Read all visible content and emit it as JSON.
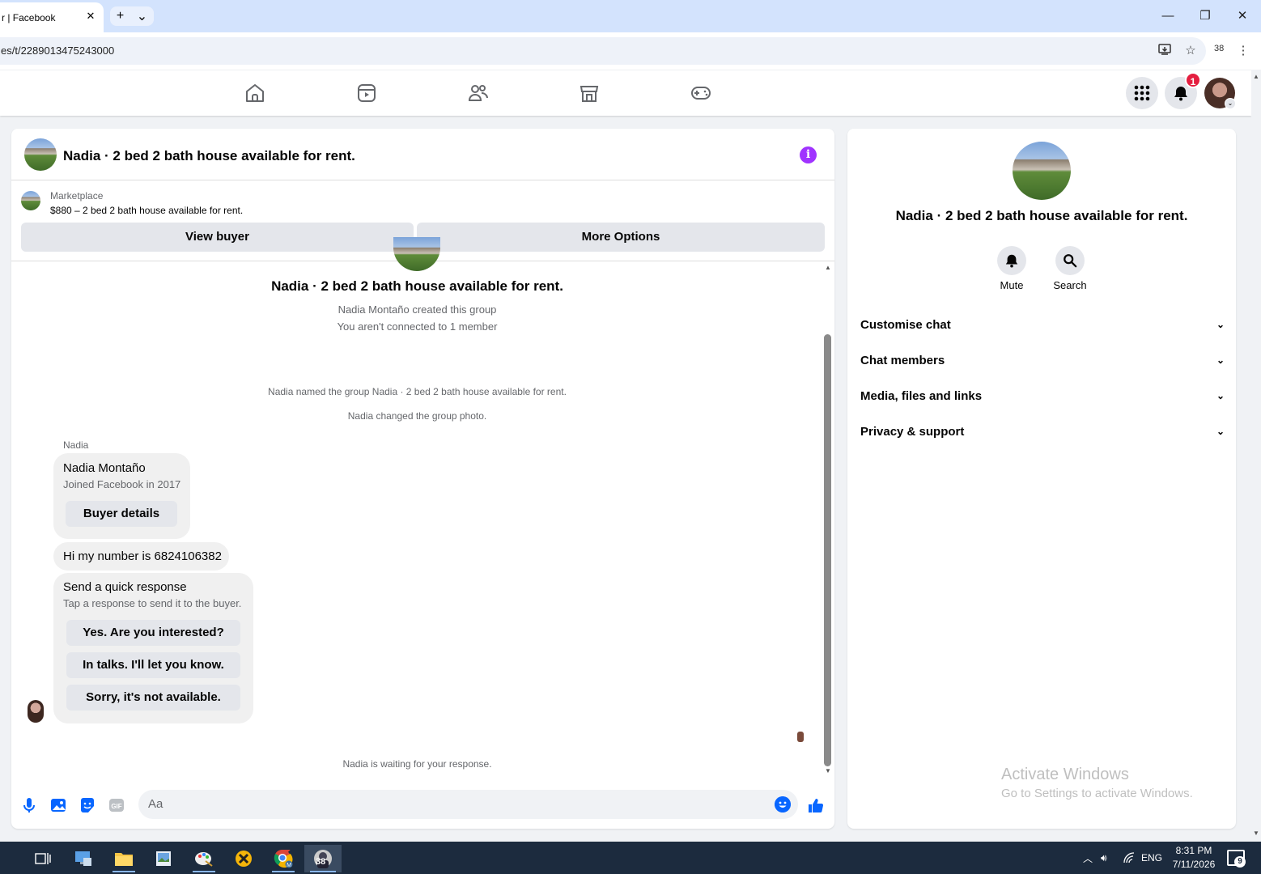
{
  "browser": {
    "tab_title": "r | Facebook",
    "tab_close": "✕",
    "new_tab": "+",
    "tab_list": "⌄",
    "url": "es/t/2289013475243000",
    "extensions_count": "38"
  },
  "window": {
    "minimize": "—",
    "restore": "❐",
    "close": "✕"
  },
  "header": {
    "notification_count": "1"
  },
  "chat": {
    "title": "Nadia · 2 bed 2 bath house available for rent.",
    "marketplace_label": "Marketplace",
    "listing": "$880 – 2 bed 2 bath house available for rent.",
    "view_buyer": "View buyer",
    "more_options": "More Options",
    "group_title": "Nadia · 2 bed 2 bath house available for rent.",
    "created_by": "Nadia Montaño created this group",
    "not_connected": "You aren't connected to 1 member",
    "named_group": "Nadia named the group Nadia · 2 bed 2 bath house available for rent.",
    "changed_photo": "Nadia changed the group photo.",
    "sender": "Nadia",
    "profile_name": "Nadia Montaño",
    "profile_joined": "Joined Facebook in 2017",
    "buyer_details": "Buyer details",
    "message": "Hi my number is 6824106382",
    "quick_response_title": "Send a quick response",
    "quick_response_subtitle": "Tap a response to send it to the buyer.",
    "quick_responses": [
      "Yes. Are you interested?",
      "In talks. I'll let you know.",
      "Sorry, it's not available."
    ],
    "waiting": "Nadia is waiting for your response.",
    "composer_placeholder": "Aa"
  },
  "details": {
    "title": "Nadia · 2 bed 2 bath house available for rent.",
    "mute": "Mute",
    "search": "Search",
    "sections": [
      "Customise chat",
      "Chat members",
      "Media, files and links",
      "Privacy & support"
    ]
  },
  "watermark": {
    "line1": "Activate Windows",
    "line2": "Go to Settings to activate Windows."
  },
  "taskbar": {
    "chrome_badge": "38",
    "language": "ENG",
    "time": "8:31 PM",
    "date": "7/11/2026",
    "notifications": "9"
  },
  "colors": {
    "fb_blue": "#0866ff",
    "info_purple": "#a033ff",
    "badge_red": "#e41e3f"
  }
}
